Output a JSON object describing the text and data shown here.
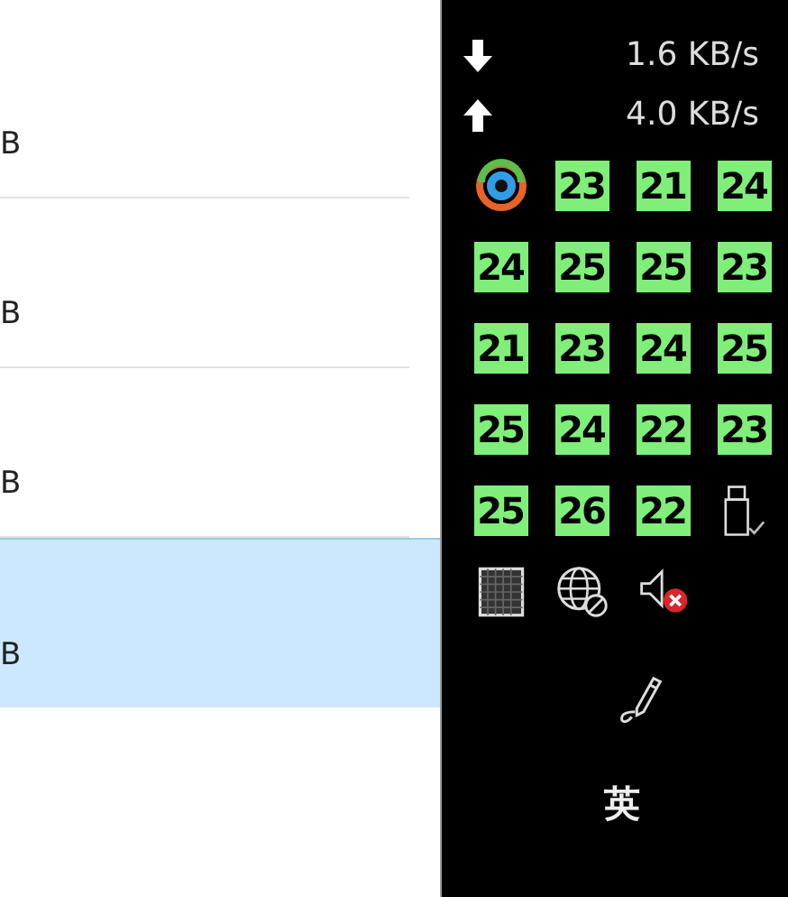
{
  "list": {
    "rows": [
      {
        "text": "B",
        "selected": false
      },
      {
        "text": "B",
        "selected": false
      },
      {
        "text": "B",
        "selected": false
      },
      {
        "text": "B",
        "selected": true
      }
    ]
  },
  "tray": {
    "network": [
      {
        "kind": "download",
        "text": "1.6 KB/s"
      },
      {
        "kind": "upload",
        "text": "4.0 KB/s"
      }
    ],
    "icons": [
      {
        "kind": "app"
      },
      {
        "kind": "temp",
        "text": "23"
      },
      {
        "kind": "temp",
        "text": "21"
      },
      {
        "kind": "temp",
        "text": "24"
      },
      {
        "kind": "temp",
        "text": "24"
      },
      {
        "kind": "temp",
        "text": "25"
      },
      {
        "kind": "temp",
        "text": "25"
      },
      {
        "kind": "temp",
        "text": "23"
      },
      {
        "kind": "temp",
        "text": "21"
      },
      {
        "kind": "temp",
        "text": "23"
      },
      {
        "kind": "temp",
        "text": "24"
      },
      {
        "kind": "temp",
        "text": "25"
      },
      {
        "kind": "temp",
        "text": "25"
      },
      {
        "kind": "temp",
        "text": "24"
      },
      {
        "kind": "temp",
        "text": "22"
      },
      {
        "kind": "temp",
        "text": "23"
      },
      {
        "kind": "temp",
        "text": "25"
      },
      {
        "kind": "temp",
        "text": "26"
      },
      {
        "kind": "temp",
        "text": "22"
      },
      {
        "kind": "usb"
      },
      {
        "kind": "grid"
      },
      {
        "kind": "network"
      },
      {
        "kind": "volume",
        "muted": true
      }
    ],
    "pen": {
      "kind": "pen"
    },
    "ime": {
      "text": "英"
    }
  }
}
